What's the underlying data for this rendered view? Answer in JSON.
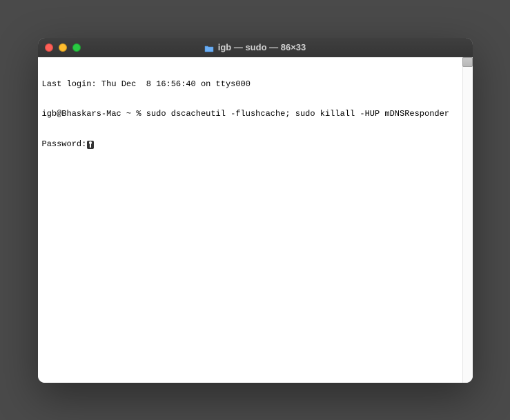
{
  "window": {
    "title": "igb — sudo — 86×33"
  },
  "terminal": {
    "line1": "Last login: Thu Dec  8 16:56:40 on ttys000",
    "prompt_user_host": "igb@Bhaskars-Mac ~ % ",
    "command": "sudo dscacheutil -flushcache; sudo killall -HUP mDNSResponder",
    "password_label": "Password:"
  }
}
